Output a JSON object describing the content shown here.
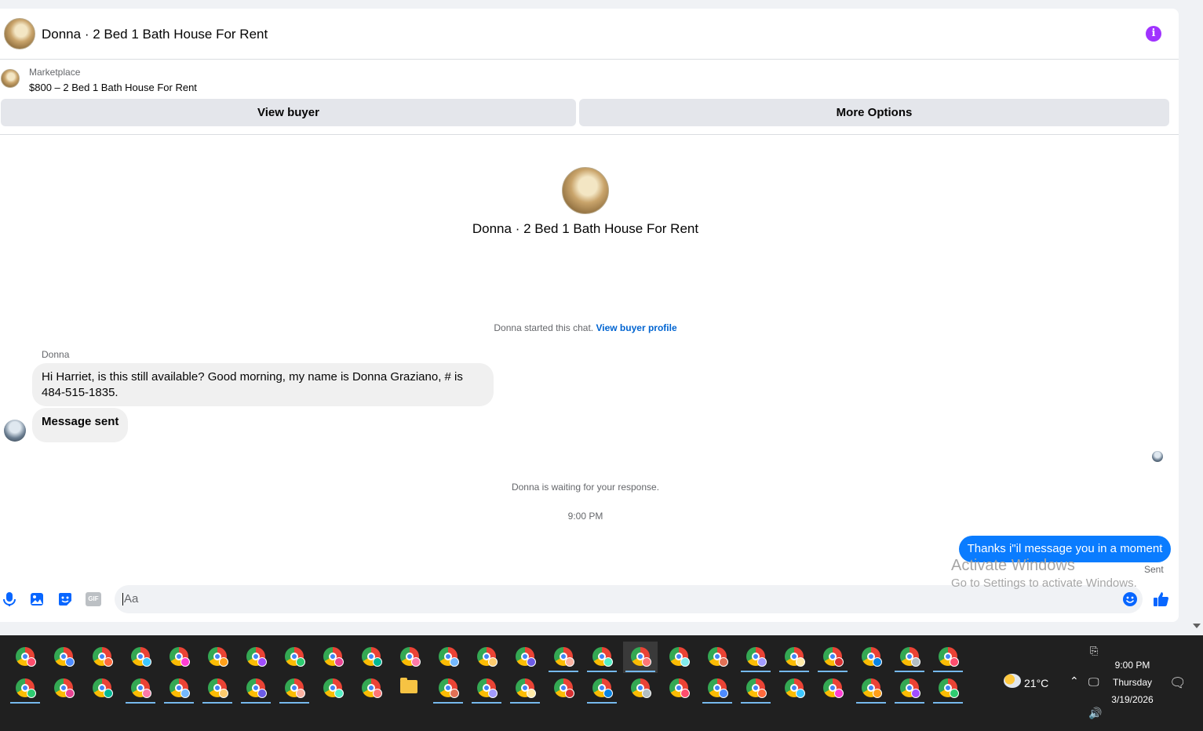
{
  "header": {
    "title": "Donna · 2 Bed 1 Bath House For Rent",
    "info_icon": "info-icon",
    "info_glyph": "i"
  },
  "listing": {
    "label": "Marketplace",
    "price_title": "$800 – 2 Bed 1 Bath House For Rent"
  },
  "actions": {
    "view_buyer": "View buyer",
    "more_options": "More Options"
  },
  "chat_intro": {
    "title": "Donna · 2 Bed 1 Bath House For Rent"
  },
  "started": {
    "text": "Donna started this chat.",
    "link": "View buyer profile"
  },
  "messages": {
    "sender": "Donna",
    "incoming_1": "Hi Harriet, is this still available? Good morning, my name is Donna Graziano, # is 484-515-1835.",
    "incoming_2": "Message sent",
    "waiting": "Donna is waiting for your response.",
    "timestamp": "9:00 PM",
    "outgoing_1": "Thanks i\"il message you in a moment",
    "status": "Sent"
  },
  "composer": {
    "placeholder": "Aa",
    "icons": [
      "microphone-icon",
      "image-icon",
      "sticker-icon",
      "gif-icon",
      "emoji-icon",
      "like-icon"
    ],
    "gif_label": "GIF"
  },
  "watermark": {
    "line1": "Activate Windows",
    "line2": "Go to Settings to activate Windows."
  },
  "taskbar": {
    "weather": "21°C",
    "time": "9:00 PM",
    "day": "Thursday",
    "date": "3/19/2026",
    "accent": "#76b9ed"
  },
  "colors": {
    "messenger_blue": "#0a7cff",
    "accent": "#0866ff",
    "info": "#a033ff"
  }
}
